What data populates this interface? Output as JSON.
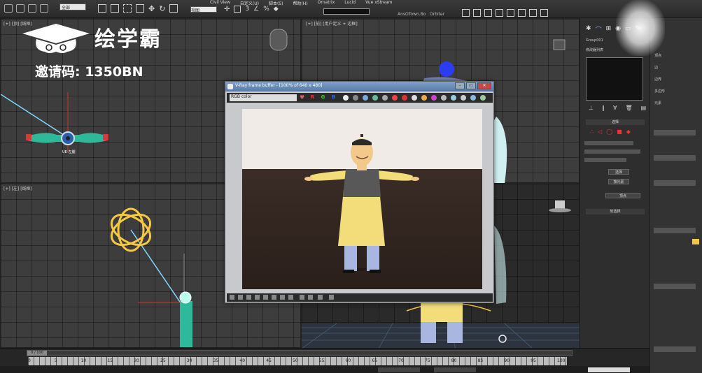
{
  "menubar": [
    "Civil View",
    "自定义(U)",
    "脚本(S)",
    "帮助(H)",
    "Ornatrix",
    "Lucid",
    "Vue xStream"
  ],
  "toolbar": {
    "selection_filter": "全部",
    "ref_coord": "视图",
    "label_a": "AnsOTown.Bo",
    "label_b": "Orbiter"
  },
  "viewports": {
    "top_left_label": "[+] [顶] [线框]",
    "bottom_left_label": "[+] [左] [线框]",
    "top_right_label": "[+] [前] [用户定义 + 边框]",
    "object_label": "UE-左腿"
  },
  "logo": {
    "text": "绘学霸",
    "invite": "邀请码: 1350BN"
  },
  "vfb": {
    "title": "V-Ray frame buffer - [100% of 640 x 480]",
    "channel": "RGB color",
    "channel_buttons": [
      "R",
      "G",
      "B"
    ]
  },
  "command_panel": {
    "object_name": "Group001",
    "modifier_list": "修改器列表",
    "section_a": "选择",
    "section_b": "软选择",
    "button_a": "选择",
    "button_b": "按元素",
    "list_items": [
      "顶点",
      "边",
      "边界",
      "多边形",
      "元素"
    ]
  },
  "timeline": {
    "handle": "0 / 100",
    "ticks": [
      "0",
      "5",
      "10",
      "15",
      "20",
      "25",
      "30",
      "35",
      "40",
      "45",
      "50",
      "55",
      "60",
      "65",
      "70",
      "75",
      "80",
      "85",
      "90",
      "95",
      "100"
    ]
  },
  "colors": {
    "accent": "#f5c842",
    "vfb_title": "#5679a8",
    "coat": "#f2dd7a",
    "pants": "#a9b6e0",
    "vest": "#555555",
    "skin": "#f3c88b"
  }
}
